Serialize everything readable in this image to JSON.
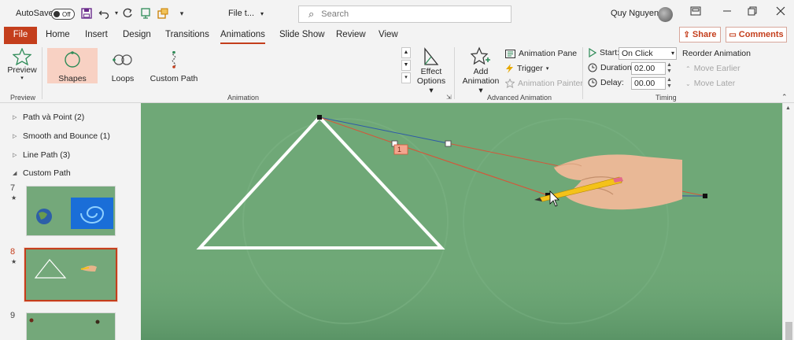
{
  "titlebar": {
    "autosave_label": "AutoSave",
    "autosave_state": "Off",
    "filename": "File t...",
    "search_placeholder": "Search",
    "user_name": "Quy Nguyen"
  },
  "tabs": [
    "File",
    "Home",
    "Insert",
    "Design",
    "Transitions",
    "Animations",
    "Slide Show",
    "Review",
    "View"
  ],
  "active_tab": "Animations",
  "share_label": "Share",
  "comments_label": "Comments",
  "ribbon": {
    "preview": {
      "label": "Preview",
      "group": "Preview"
    },
    "animation": {
      "items": [
        "Shapes",
        "Loops",
        "Custom Path"
      ],
      "selected": "Shapes",
      "effect_options_line1": "Effect",
      "effect_options_line2": "Options",
      "group": "Animation"
    },
    "advanced": {
      "add_animation_line1": "Add",
      "add_animation_line2": "Animation",
      "animation_pane": "Animation Pane",
      "trigger": "Trigger",
      "animation_painter": "Animation Painter",
      "group": "Advanced Animation"
    },
    "timing": {
      "start_label": "Start:",
      "start_value": "On Click",
      "duration_label": "Duration:",
      "duration_value": "02.00",
      "delay_label": "Delay:",
      "delay_value": "00.00",
      "reorder_label": "Reorder Animation",
      "move_earlier": "Move Earlier",
      "move_later": "Move Later",
      "group": "Timing"
    }
  },
  "sections": [
    {
      "name": "Path và Point (2)",
      "expanded": false
    },
    {
      "name": "Smooth and Bounce (1)",
      "expanded": false
    },
    {
      "name": "Line Path (3)",
      "expanded": false
    },
    {
      "name": "Custom Path",
      "expanded": true
    }
  ],
  "thumbnails": [
    {
      "number": "7",
      "star": "★"
    },
    {
      "number": "8",
      "star": "★"
    },
    {
      "number": "9"
    }
  ],
  "slide": {
    "background": "#6fa877",
    "animation_tag": "1"
  },
  "colors": {
    "accent": "#c43e1c",
    "slide_green": "#6fa877",
    "path_red": "#d4573a",
    "path_blue": "#2e5aa8"
  }
}
